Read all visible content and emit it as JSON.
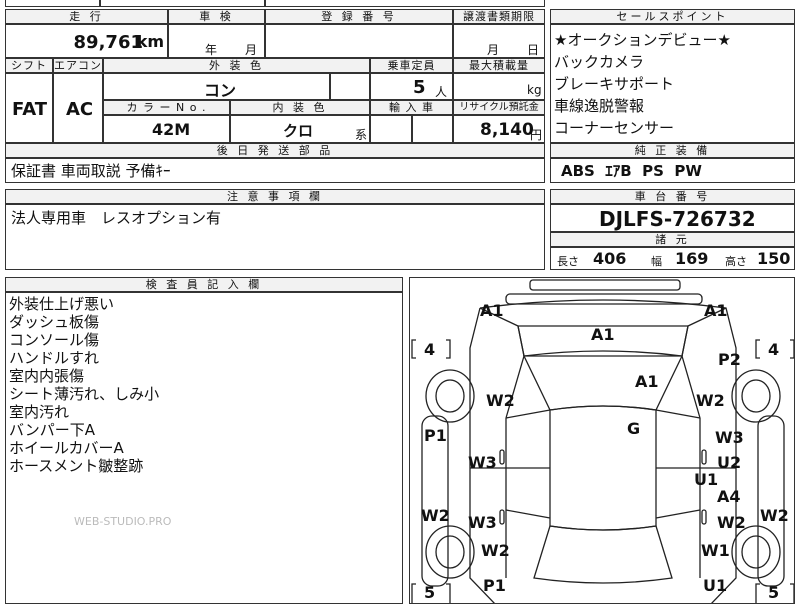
{
  "header": {
    "mileage_label": "走 行",
    "inspection_label": "車 検",
    "registration_label": "登 録 番 号",
    "transfer_label": "譲渡書類期限",
    "selling_label": "セールスポイント",
    "mileage_value": "89,761",
    "mileage_unit": "km",
    "year_unit": "年",
    "month_unit": "月",
    "transfer_month": "月",
    "transfer_day": "日"
  },
  "row2": {
    "shift_label": "シフト",
    "aircon_label": "エアコン",
    "exterior_label": "外 装 色",
    "capacity_label": "乗車定員",
    "maxload_label": "最大積載量",
    "exterior_value": "コン",
    "capacity_value": "5",
    "capacity_unit": "人",
    "maxload_unit": "kg",
    "shift_value": "FAT",
    "aircon_value": "AC",
    "color_no_label": "カ ラ ー  N o .",
    "interior_label": "内 装 色",
    "import_label": "輸 入 車",
    "recycle_label": "リサイクル預託金",
    "color_no_value": "42M",
    "interior_value": "クロ",
    "interior_unit": "系",
    "recycle_value": "8,140",
    "recycle_unit": "円"
  },
  "selling_points": [
    "★オークションデビュー★",
    "バックカメラ",
    "ブレーキサポート",
    "車線逸脱警報",
    "コーナーセンサー"
  ],
  "equipment": {
    "label": "純 正 装 備",
    "value": "ABS  ｴｱB  PS  PW"
  },
  "extras": {
    "label": "後 日 発 送 部 品",
    "value": "保証書  車両取説  予備ｷｰ"
  },
  "notes": {
    "label": "注 意 事 項 欄",
    "value": "法人専用車　レスオプション有"
  },
  "chassis": {
    "label": "車 台 番 号",
    "value": "DJLFS-726732",
    "specs_label": "諸 元",
    "length_label": "長さ",
    "length_value": "406",
    "width_label": "幅",
    "width_value": "169",
    "height_label": "高さ",
    "height_value": "150"
  },
  "inspector": {
    "label": "検 査 員 記 入 欄",
    "lines": [
      "外装仕上げ悪い",
      "ダッシュ板傷",
      "コンソール傷",
      "ハンドルすれ",
      "室内内張傷",
      "シート薄汚れ、しみ小",
      "室内汚れ",
      "バンパー下A",
      "ホイールカバーA",
      "ホースメント皺整跡"
    ],
    "watermark": "WEB-STUDIO.PRO"
  },
  "diagram": {
    "tire_top_left": "4",
    "tire_top_right": "4",
    "tire_bottom_left": "5",
    "tire_bottom_right": "5",
    "marks": {
      "a1_front_left": "A1",
      "a1_front_right": "A1",
      "a1_hood": "A1",
      "a1_windshield": "A1",
      "p2_right_fender": "P2",
      "w2_left_fender": "W2",
      "w2_right_fender": "W2",
      "g_roof": "G",
      "p1_left_side": "P1",
      "w3_right_front_door": "W3",
      "w3_left_front_door": "W3",
      "u2_right_front_door": "U2",
      "u1_right_mid": "U1",
      "a4_right_rear_door": "A4",
      "w3_left_rear_door": "W3",
      "w2_right_rear_door": "W2",
      "w2_far_left": "W2",
      "w2_far_right": "W2",
      "w2_left_rear_fender": "W2",
      "w1_right_rear_fender": "W1",
      "p1_rear_left": "P1",
      "u1_rear_right": "U1"
    }
  }
}
